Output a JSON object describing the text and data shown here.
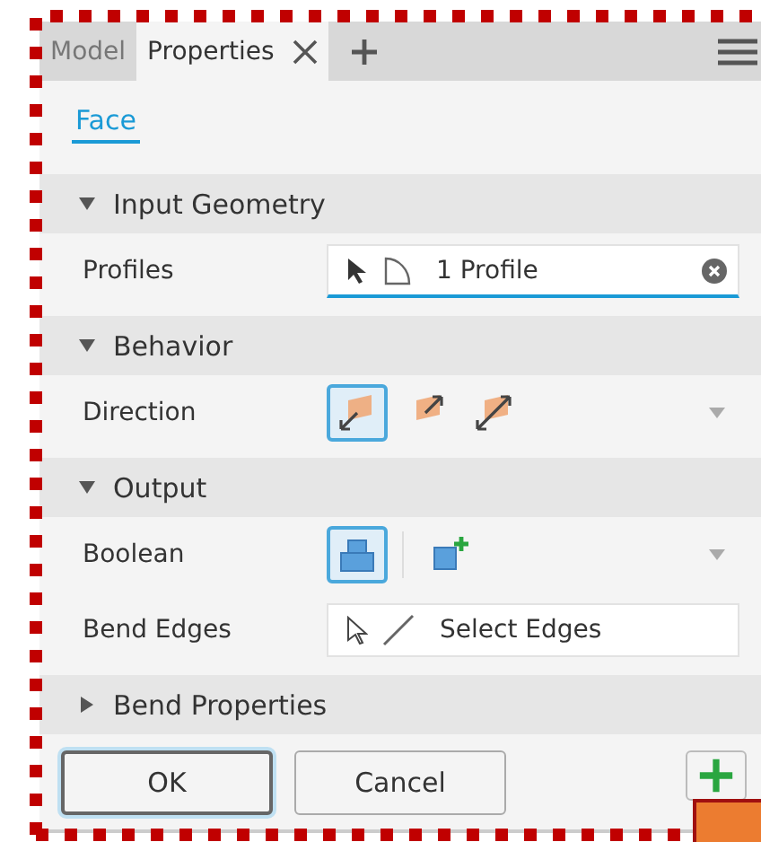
{
  "tabs": [
    {
      "label": "Model",
      "selected": false,
      "closable": false
    },
    {
      "label": "Properties",
      "selected": true,
      "closable": true
    }
  ],
  "sub_tabs": [
    {
      "label": "Face",
      "selected": true
    }
  ],
  "sections": [
    {
      "title": "Input Geometry",
      "expanded": true,
      "rows": [
        {
          "label": "Profiles",
          "kind": "select",
          "value": "1 Profile",
          "clearable": true
        }
      ]
    },
    {
      "title": "Behavior",
      "expanded": true,
      "rows": [
        {
          "label": "Direction",
          "kind": "options",
          "options": [
            {
              "selected": true
            },
            {
              "selected": false
            },
            {
              "selected": false
            }
          ]
        }
      ]
    },
    {
      "title": "Output",
      "expanded": true,
      "rows": [
        {
          "label": "Boolean",
          "kind": "options",
          "options": [
            {
              "selected": true
            },
            {
              "selected": false
            }
          ]
        },
        {
          "label": "Bend Edges",
          "kind": "select",
          "value": "Select Edges",
          "clearable": false
        }
      ]
    },
    {
      "title": "Bend Properties",
      "expanded": false
    }
  ],
  "buttons": [
    {
      "label": "OK",
      "default": true
    },
    {
      "label": "Cancel",
      "default": false
    }
  ]
}
